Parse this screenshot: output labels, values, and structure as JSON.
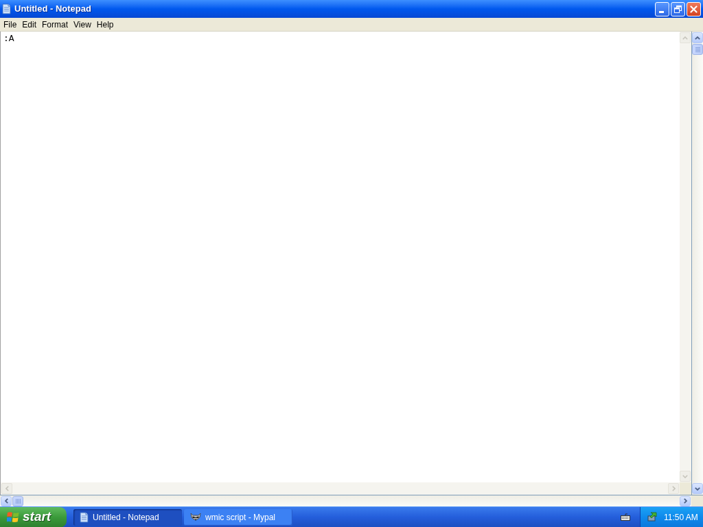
{
  "window": {
    "title": "Untitled - Notepad",
    "menu": [
      "File",
      "Edit",
      "Format",
      "View",
      "Help"
    ]
  },
  "document": {
    "text": ":A"
  },
  "taskbar": {
    "start": "start",
    "tasks": [
      {
        "label": "Untitled - Notepad",
        "selected": true
      },
      {
        "label": "wmic script - Mypal",
        "selected": false
      }
    ],
    "clock": "11:50 AM"
  }
}
